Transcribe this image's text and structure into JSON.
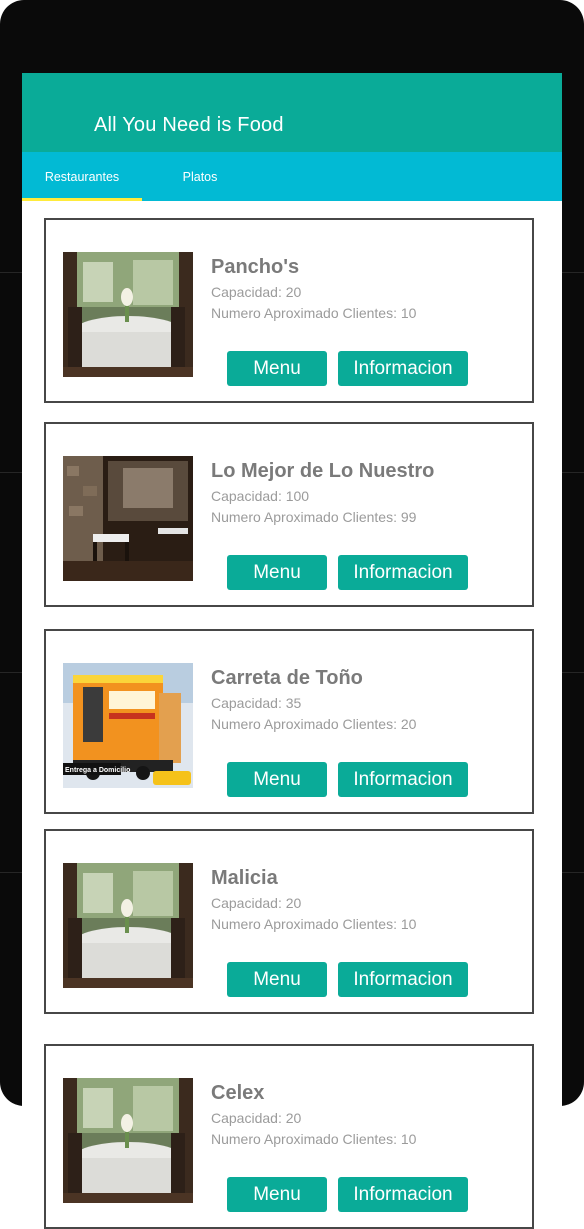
{
  "app": {
    "title": "All You Need is Food"
  },
  "tabs": [
    {
      "label": "Restaurantes",
      "selected": true
    },
    {
      "label": "Platos",
      "selected": false
    }
  ],
  "colors": {
    "appbar": "#0aab98",
    "tabs": "#02bad4",
    "indicator": "#ffeb3b",
    "button": "#0aab98"
  },
  "restaurants": [
    {
      "name": "Pancho's",
      "capacity": "Capacidad: 20",
      "clients": "Numero Aproximado Clientes: 10",
      "menu_label": "Menu",
      "info_label": "Informacion",
      "image": "dining-room-photo"
    },
    {
      "name": "Lo Mejor de Lo Nuestro",
      "capacity": "Capacidad: 100",
      "clients": "Numero Aproximado Clientes: 99",
      "menu_label": "Menu",
      "info_label": "Informacion",
      "image": "restaurant-interior-photo"
    },
    {
      "name": "Carreta de Toño",
      "capacity": "Capacidad: 35",
      "clients": "Numero Aproximado Clientes: 20",
      "menu_label": "Menu",
      "info_label": "Informacion",
      "image": "food-truck-photo",
      "image_text": "Entrega a Domicilio"
    },
    {
      "name": "Malicia",
      "capacity": "Capacidad: 20",
      "clients": "Numero Aproximado Clientes: 10",
      "menu_label": "Menu",
      "info_label": "Informacion",
      "image": "dining-room-photo"
    },
    {
      "name": "Celex",
      "capacity": "Capacidad: 20",
      "clients": "Numero Aproximado Clientes: 10",
      "menu_label": "Menu",
      "info_label": "Informacion",
      "image": "dining-room-photo"
    }
  ]
}
